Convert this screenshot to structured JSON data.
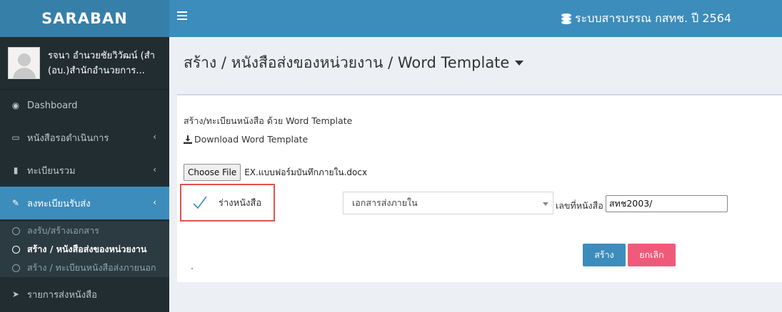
{
  "logo": "SARABAN",
  "user": {
    "name": "รจนา อำนวยชัยวิวัฒน์ (สำ",
    "unit": "(อบ.)สำนักอำนวยการ..."
  },
  "menu": {
    "dashboard": "Dashboard",
    "pending": "หนังสือรอดำเนินการ",
    "registry": "ทะเบียนรวม",
    "register_send": "ลงทะเบียนรับส่ง",
    "sub": [
      "ลงรับ/สร้างเอกสาร",
      "สร้าง / หนังสือส่งของหน่วยงาน",
      "สร้าง / ทะเบียนหนังสือส่งภายนอก"
    ],
    "send_list": "รายการส่งหนังสือ"
  },
  "topbar": {
    "system_title": "ระบบสารบรรณ กสทช. ปี 2564"
  },
  "page": {
    "title": "สร้าง / หนังสือส่งของหน่วยงาน / Word Template"
  },
  "form": {
    "intro": "สร้าง/ทะเบียนหนังสือ ด้วย Word Template",
    "download": "Download Word Template",
    "choose_file": "Choose File",
    "file_name": "EX.แบบฟอร์มบันทึกภายใน.docx",
    "draft_label": "ร่างหนังสือ",
    "doc_type": "เอกสารส่งภายใน",
    "doc_no_label": "เลขที่หนังสือ",
    "doc_no": "สทช2003/",
    "create": "สร้าง",
    "cancel": "ยกเลิก"
  },
  "colors": {
    "topbar": "#3c8dbc",
    "sidebar": "#222d32",
    "logo_bg": "#367fa9",
    "cancel": "#f05a7a",
    "highlight": "#e0534d"
  }
}
